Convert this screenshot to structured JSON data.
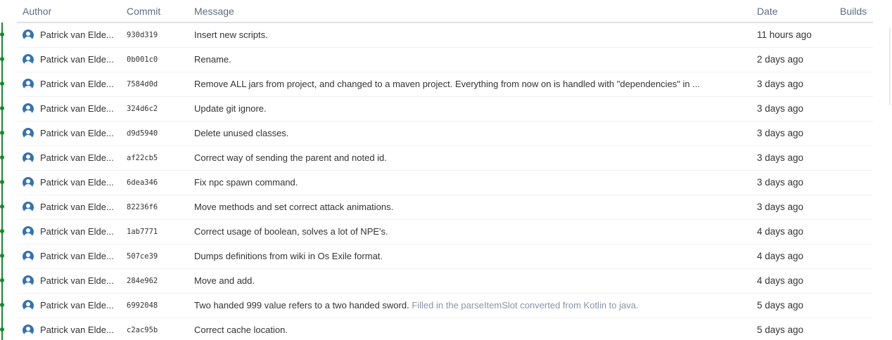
{
  "columns": {
    "author": "Author",
    "commit": "Commit",
    "message": "Message",
    "date": "Date",
    "builds": "Builds"
  },
  "graph_color": "#14892c",
  "avatar_color": "#3572b0",
  "commits": [
    {
      "author": "Patrick van Elde...",
      "hash": "930d319",
      "message": "Insert new scripts.",
      "extra": "",
      "date": "11 hours ago"
    },
    {
      "author": "Patrick van Elde...",
      "hash": "0b001c0",
      "message": "Rename.",
      "extra": "",
      "date": "2 days ago"
    },
    {
      "author": "Patrick van Elde...",
      "hash": "7584d0d",
      "message": "Remove ALL jars from project, and changed to a maven project. Everything from now on is handled with \"dependencies\" in ...",
      "extra": "",
      "date": "3 days ago"
    },
    {
      "author": "Patrick van Elde...",
      "hash": "324d6c2",
      "message": "Update git ignore.",
      "extra": "",
      "date": "3 days ago"
    },
    {
      "author": "Patrick van Elde...",
      "hash": "d9d5940",
      "message": "Delete unused classes.",
      "extra": "",
      "date": "3 days ago"
    },
    {
      "author": "Patrick van Elde...",
      "hash": "af22cb5",
      "message": "Correct way of sending the parent and noted id.",
      "extra": "",
      "date": "3 days ago"
    },
    {
      "author": "Patrick van Elde...",
      "hash": "6dea346",
      "message": "Fix npc spawn command.",
      "extra": "",
      "date": "3 days ago"
    },
    {
      "author": "Patrick van Elde...",
      "hash": "82236f6",
      "message": "Move methods and set correct attack animations.",
      "extra": "",
      "date": "3 days ago"
    },
    {
      "author": "Patrick van Elde...",
      "hash": "1ab7771",
      "message": "Correct usage of boolean, solves a lot of NPE's.",
      "extra": "",
      "date": "4 days ago"
    },
    {
      "author": "Patrick van Elde...",
      "hash": "507ce39",
      "message": "Dumps definitions from wiki in Os Exile format.",
      "extra": "",
      "date": "4 days ago"
    },
    {
      "author": "Patrick van Elde...",
      "hash": "284e962",
      "message": "Move and add.",
      "extra": "",
      "date": "4 days ago"
    },
    {
      "author": "Patrick van Elde...",
      "hash": "6992048",
      "message": "Two handed 999 value refers to a two handed sword.",
      "extra": "Filled in the parseItemSlot converted from Kotlin to java.",
      "date": "5 days ago"
    },
    {
      "author": "Patrick van Elde...",
      "hash": "c2ac95b",
      "message": "Correct cache location.",
      "extra": "",
      "date": "5 days ago"
    }
  ]
}
